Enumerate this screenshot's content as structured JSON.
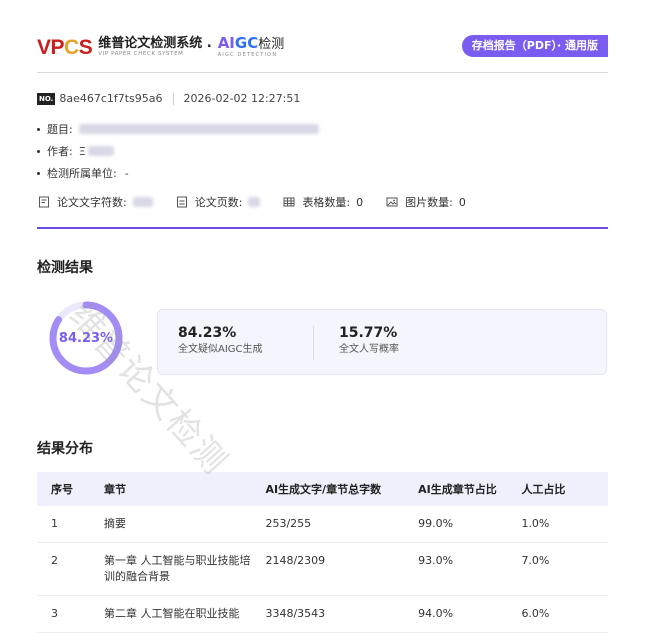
{
  "header": {
    "brand_en": "VPCS",
    "brand_cn": "维普论文检测系统 .",
    "brand_sub": "VIP PAPER CHECK SYSTEM",
    "aigc_part1": "AI",
    "aigc_part2": "GC",
    "aigc_part3": "检测",
    "aigc_sub": "AIGC DETECTION",
    "report_type": "存档报告（PDF）· 通用版"
  },
  "meta": {
    "no_label": "NO.",
    "report_id": "8ae467c1f7ts95a6",
    "datetime": "2026-02-02 12:27:51",
    "title_label": "题目:",
    "author_label": "作者:",
    "author_initial": "Ξ",
    "unit_label": "检测所属单位:",
    "unit_value": "-"
  },
  "stats": {
    "word_count_label": "论文文字符数:",
    "page_count_label": "论文页数:",
    "table_count_label": "表格数量:",
    "table_count": "0",
    "image_count_label": "图片数量:",
    "image_count": "0"
  },
  "results": {
    "section_title": "检测结果",
    "ring_value": "84.23%",
    "ring_fraction": 0.8423,
    "aigc_value": "84.23%",
    "aigc_label": "全文疑似AIGC生成",
    "human_value": "15.77%",
    "human_label": "全文人写概率"
  },
  "distribution": {
    "section_title": "结果分布",
    "headers": [
      "序号",
      "章节",
      "AI生成文字/章节总字数",
      "AI生成章节占比",
      "人工占比"
    ],
    "rows": [
      {
        "index": "1",
        "chapter": "摘要",
        "ratio": "253/255",
        "ai_pct": "99.0%",
        "human_pct": "1.0%"
      },
      {
        "index": "2",
        "chapter": "第一章 人工智能与职业技能培训的融合背景",
        "ratio": "2148/2309",
        "ai_pct": "93.0%",
        "human_pct": "7.0%"
      },
      {
        "index": "3",
        "chapter": "第二章 人工智能在职业技能",
        "ratio": "3348/3543",
        "ai_pct": "94.0%",
        "human_pct": "6.0%"
      }
    ]
  },
  "watermark": "维普论文检测",
  "colors": {
    "accent": "#7b5cf0",
    "brand_red": "#c8201f",
    "brand_gold": "#e4a42a"
  }
}
